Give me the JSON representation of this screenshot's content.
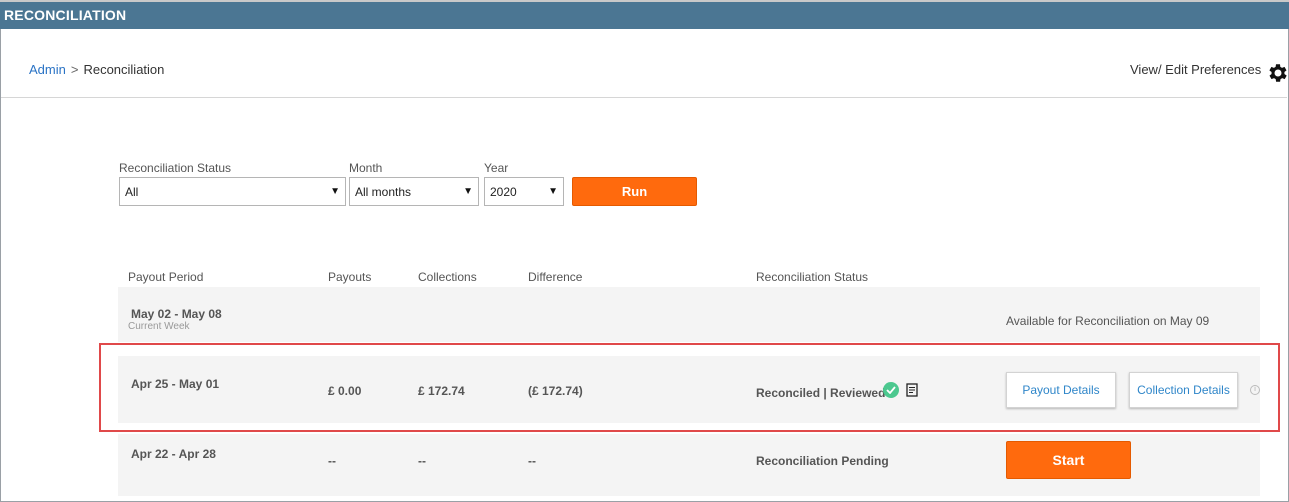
{
  "header": {
    "title": "RECONCILIATION"
  },
  "breadcrumb": {
    "admin": "Admin",
    "separator": ">",
    "current": "Reconciliation"
  },
  "preferences": {
    "label": "View/ Edit Preferences"
  },
  "filters": {
    "status": {
      "label": "Reconciliation Status",
      "value": "All"
    },
    "month": {
      "label": "Month",
      "value": "All months"
    },
    "year": {
      "label": "Year",
      "value": "2020"
    },
    "run_label": "Run"
  },
  "table": {
    "headers": {
      "period": "Payout Period",
      "payouts": "Payouts",
      "collections": "Collections",
      "difference": "Difference",
      "status": "Reconciliation Status"
    },
    "rows": [
      {
        "period": "May 02 - May 08",
        "sub": "Current Week",
        "availability": "Available for Reconciliation on May 09"
      },
      {
        "period": "Apr 25 - May 01",
        "payouts": "£ 0.00",
        "collections": "£ 172.74",
        "difference": "(£ 172.74)",
        "status": "Reconciled | Reviewed",
        "payout_details_label": "Payout Details",
        "collection_details_label": "Collection Details"
      },
      {
        "period": "Apr 22 - Apr 28",
        "payouts": "--",
        "collections": "--",
        "difference": "--",
        "status": "Reconciliation Pending",
        "start_label": "Start"
      }
    ]
  },
  "colors": {
    "header_bg": "#4b7693",
    "accent_orange": "#ff6a0d",
    "link_blue": "#2a73c5",
    "highlight_red": "#e0494a",
    "check_green": "#4cc88f"
  },
  "icons": [
    "gear-icon",
    "check-circle-icon",
    "notes-icon",
    "info-icon",
    "caret-down-icon"
  ]
}
